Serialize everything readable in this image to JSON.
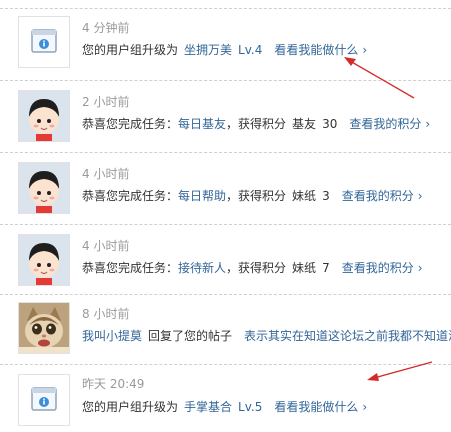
{
  "feed": [
    {
      "time": "4 分钟前",
      "prefix": "您的用户组升级为",
      "group": "坐拥万美",
      "level": "Lv.4",
      "action": "看看我能做什么",
      "chevron": "›"
    },
    {
      "time": "2 小时前",
      "prefix": "恭喜您完成任务：",
      "task": "每日基友",
      "mid": "，获得积分",
      "reward_name": "基友",
      "reward_value": "30",
      "action": "查看我的积分",
      "chevron": "›"
    },
    {
      "time": "4 小时前",
      "prefix": "恭喜您完成任务：",
      "task": "每日帮助",
      "mid": "，获得积分",
      "reward_name": "妹纸",
      "reward_value": "3",
      "action": "查看我的积分",
      "chevron": "›"
    },
    {
      "time": "4 小时前",
      "prefix": "恭喜您完成任务：",
      "task": "接待新人",
      "mid": "，获得积分",
      "reward_name": "妹纸",
      "reward_value": "7",
      "action": "查看我的积分",
      "chevron": "›"
    },
    {
      "time": "8 小时前",
      "user": "我叫小提莫",
      "verb": "回复了您的帖子",
      "thread": "表示其实在知道这论坛之前我都不知道汤"
    },
    {
      "time": "昨天 20:49",
      "prefix": "您的用户组升级为",
      "group": "手掌基合",
      "level": "Lv.5",
      "action": "看看我能做什么",
      "chevron": "›"
    }
  ],
  "icons": {
    "system": "system-notice-icon",
    "avatar": "cartoon-avatar-icon",
    "cat": "cat-avatar-image"
  },
  "colors": {
    "link": "#336699",
    "time": "#9a9a9a",
    "text": "#333333",
    "annotation_arrow": "#d42a2a"
  }
}
